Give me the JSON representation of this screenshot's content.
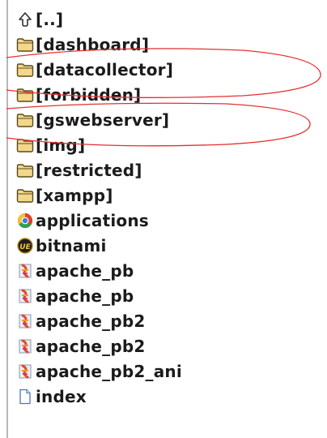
{
  "window": {
    "title": ""
  },
  "colors": {
    "folder_fill": "#f3d88b",
    "folder_stroke": "#5b4a1d",
    "annotation": "#e53030",
    "text": "#1b1b1b"
  },
  "file_list": {
    "items": [
      {
        "label": "[..]",
        "icon": "up-arrow-icon",
        "type": "parent"
      },
      {
        "label": "[dashboard]",
        "icon": "folder-icon",
        "type": "folder"
      },
      {
        "label": "[datacollector]",
        "icon": "folder-icon",
        "type": "folder"
      },
      {
        "label": "[forbidden]",
        "icon": "folder-icon",
        "type": "folder"
      },
      {
        "label": "[gswebserver]",
        "icon": "folder-icon",
        "type": "folder"
      },
      {
        "label": "[img]",
        "icon": "folder-icon",
        "type": "folder"
      },
      {
        "label": "[restricted]",
        "icon": "folder-icon",
        "type": "folder"
      },
      {
        "label": "[xampp]",
        "icon": "folder-icon",
        "type": "folder"
      },
      {
        "label": "applications",
        "icon": "chrome-icon",
        "type": "file"
      },
      {
        "label": "bitnami",
        "icon": "bitnami-icon",
        "type": "file"
      },
      {
        "label": "apache_pb",
        "icon": "apache-icon",
        "type": "file"
      },
      {
        "label": "apache_pb",
        "icon": "apache-icon",
        "type": "file"
      },
      {
        "label": "apache_pb2",
        "icon": "apache-icon",
        "type": "file"
      },
      {
        "label": "apache_pb2",
        "icon": "apache-icon",
        "type": "file"
      },
      {
        "label": "apache_pb2_ani",
        "icon": "apache-icon",
        "type": "file"
      },
      {
        "label": "index",
        "icon": "document-icon",
        "type": "file"
      }
    ]
  }
}
